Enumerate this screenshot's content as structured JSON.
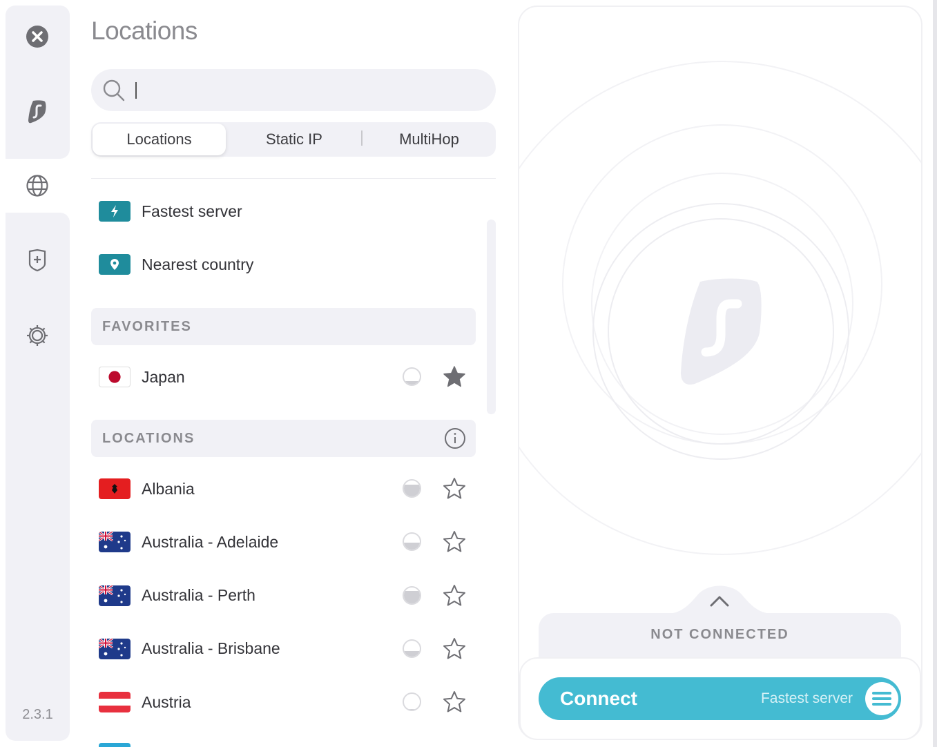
{
  "app": {
    "version": "2.3.1",
    "accent_color": "#44bbd2",
    "teal_badge_color": "#1f8c9c"
  },
  "sidebar": {
    "items": [
      {
        "name": "close",
        "icon": "close-icon"
      },
      {
        "name": "home",
        "icon": "surfshark-logo-icon"
      },
      {
        "name": "locations",
        "icon": "globe-icon",
        "active": true
      },
      {
        "name": "antivirus",
        "icon": "shield-plus-icon"
      },
      {
        "name": "settings",
        "icon": "gear-icon"
      }
    ]
  },
  "header": {
    "title": "Locations"
  },
  "search": {
    "value": "",
    "placeholder": ""
  },
  "tabs": [
    {
      "label": "Locations",
      "active": true
    },
    {
      "label": "Static IP",
      "active": false
    },
    {
      "label": "MultiHop",
      "active": false
    }
  ],
  "quick_connect": [
    {
      "label": "Fastest server",
      "icon": "lightning-icon"
    },
    {
      "label": "Nearest country",
      "icon": "location-pin-icon"
    }
  ],
  "favorites": {
    "header": "FAVORITES",
    "items": [
      {
        "label": "Japan",
        "flag": "japan",
        "load": 0.2,
        "favorite": true
      }
    ]
  },
  "locations": {
    "header": "LOCATIONS",
    "items": [
      {
        "label": "Albania",
        "flag": "albania",
        "load": 0.75,
        "favorite": false
      },
      {
        "label": "Australia - Adelaide",
        "flag": "australia",
        "load": 0.45,
        "favorite": false
      },
      {
        "label": "Australia - Perth",
        "flag": "australia",
        "load": 0.75,
        "favorite": false
      },
      {
        "label": "Australia - Brisbane",
        "flag": "australia",
        "load": 0.35,
        "favorite": false
      },
      {
        "label": "Austria",
        "flag": "austria",
        "load": 0.05,
        "favorite": false
      }
    ]
  },
  "connection": {
    "status": "NOT CONNECTED",
    "connect_label": "Connect",
    "target": "Fastest server"
  }
}
